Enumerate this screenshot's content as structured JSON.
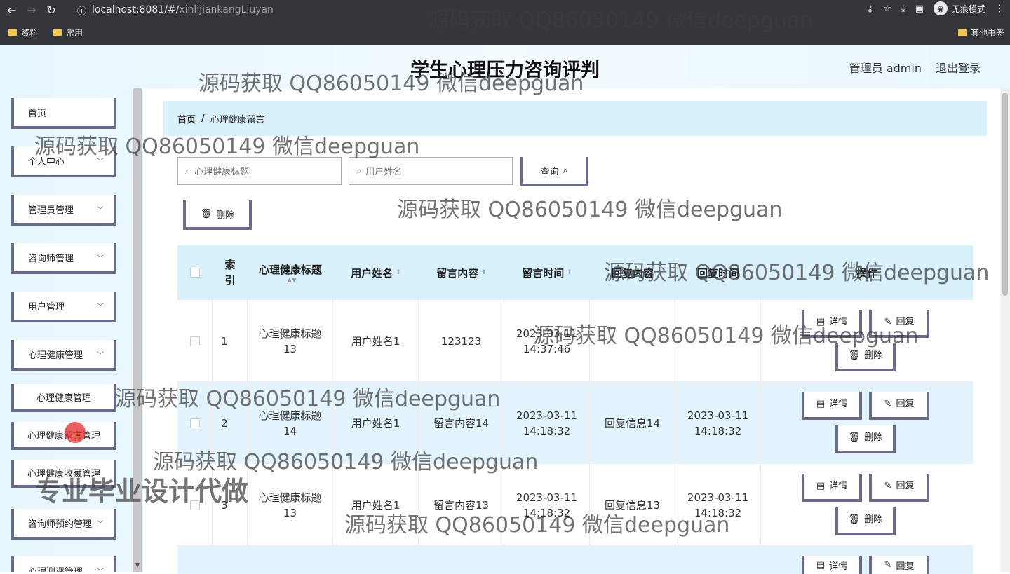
{
  "browser": {
    "url_host": "localhost:8081/#/",
    "url_path": "xinlijiankangLiuyan",
    "incognito_label": "无痕模式",
    "bookmarks": [
      "资料",
      "常用"
    ],
    "bookmarks_right": "其他书签"
  },
  "header": {
    "title": "学生心理压力咨询评判",
    "user_label": "管理员 admin",
    "logout": "退出登录"
  },
  "sidebar": {
    "items": [
      {
        "label": "首页",
        "has_chevron": false
      },
      {
        "label": "个人中心",
        "has_chevron": true
      },
      {
        "label": "管理员管理",
        "has_chevron": true
      },
      {
        "label": "咨询师管理",
        "has_chevron": true
      },
      {
        "label": "用户管理",
        "has_chevron": true
      },
      {
        "label": "心理健康管理",
        "has_chevron": true
      }
    ],
    "sub_items": [
      "心理健康管理",
      "心理健康留言管理",
      "心理健康收藏管理"
    ],
    "after_items": [
      {
        "label": "咨询师预约管理",
        "has_chevron": true
      },
      {
        "label": "心理测评管理",
        "has_chevron": true
      }
    ]
  },
  "breadcrumb": {
    "home": "首页",
    "separator": "/",
    "current": "心理健康留言"
  },
  "search": {
    "title_placeholder": "心理健康标题",
    "user_placeholder": "用户姓名",
    "query_label": "查询"
  },
  "toolbar": {
    "delete_label": "删除"
  },
  "table": {
    "columns": [
      "索引",
      "心理健康标题",
      "用户姓名",
      "留言内容",
      "留言时间",
      "回复内容",
      "回复时间",
      "操作"
    ],
    "rows": [
      {
        "index": "1",
        "title": "心理健康标题13",
        "user": "用户姓名1",
        "content": "123123",
        "time": "2023-03-11 14:37:46",
        "reply": "",
        "reply_time": ""
      },
      {
        "index": "2",
        "title": "心理健康标题14",
        "user": "用户姓名1",
        "content": "留言内容14",
        "time": "2023-03-11 14:18:32",
        "reply": "回复信息14",
        "reply_time": "2023-03-11 14:18:32"
      },
      {
        "index": "3",
        "title": "心理健康标题13",
        "user": "用户姓名1",
        "content": "留言内容13",
        "time": "2023-03-11 14:18:32",
        "reply": "回复信息13",
        "reply_time": "2023-03-11 14:18:32"
      }
    ],
    "actions": {
      "detail": "详情",
      "reply": "回复",
      "delete": "删除"
    }
  },
  "watermarks": [
    "源码获取 QQ86050149 微信deepguan",
    "专业毕业设计代做"
  ]
}
